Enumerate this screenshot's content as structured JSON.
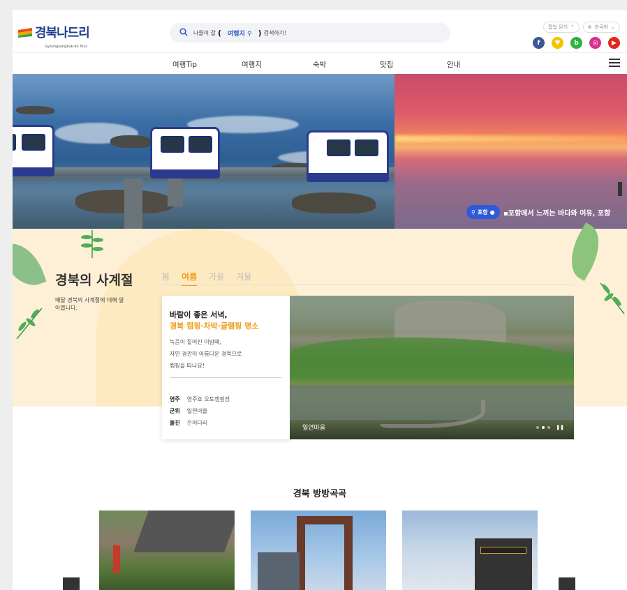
{
  "header": {
    "logo_text": "경북나드리",
    "logo_sub": "Gyeongsangbuk-do Tour",
    "search": {
      "prefix": "나들이 갈",
      "highlight": "여행지",
      "suffix": "검색하기!"
    },
    "top_buttons": [
      "팝업 닫기",
      "한국어"
    ],
    "social": [
      {
        "label": "f",
        "color": "#3b5998"
      },
      {
        "label": "♥",
        "color": "#f5c400"
      },
      {
        "label": "b",
        "color": "#2ab33f"
      },
      {
        "label": "◎",
        "color": "#d6308f"
      },
      {
        "label": "▶",
        "color": "#e4261b"
      }
    ],
    "nav": [
      "여행Tip",
      "여행지",
      "숙박",
      "맛집",
      "안내"
    ]
  },
  "hero": {
    "location_tag": "포항",
    "caption": "포항에서 느끼는 바다와 여유, 포항"
  },
  "season": {
    "title": "경북의 사계절",
    "description": "매달 경북의 사계절에 대해 알아봅니다.",
    "tabs": [
      "봄",
      "여름",
      "가을",
      "겨울"
    ],
    "active_tab": "여름",
    "card": {
      "heading1": "바람이 좋은 서녁,",
      "heading2": "경북 캠핑·차박·글램핑 명소",
      "body": [
        "녹음이 짙어진 이맘때,",
        "자연 경관이 아름다운 경북으로",
        "캠핑을 떠나요!"
      ],
      "places": [
        {
          "region": "영주",
          "name": "영주호 오토캠핑장"
        },
        {
          "region": "군위",
          "name": "일연마을"
        },
        {
          "region": "울진",
          "name": "은어다리"
        }
      ]
    },
    "photo_caption": "일연마을"
  },
  "bottom": {
    "title": "경북 방방곡곡"
  },
  "colors": {
    "accent": "#f29a1a",
    "brand_blue": "#2e5ad8",
    "season_bg": "#fdf0d6"
  }
}
